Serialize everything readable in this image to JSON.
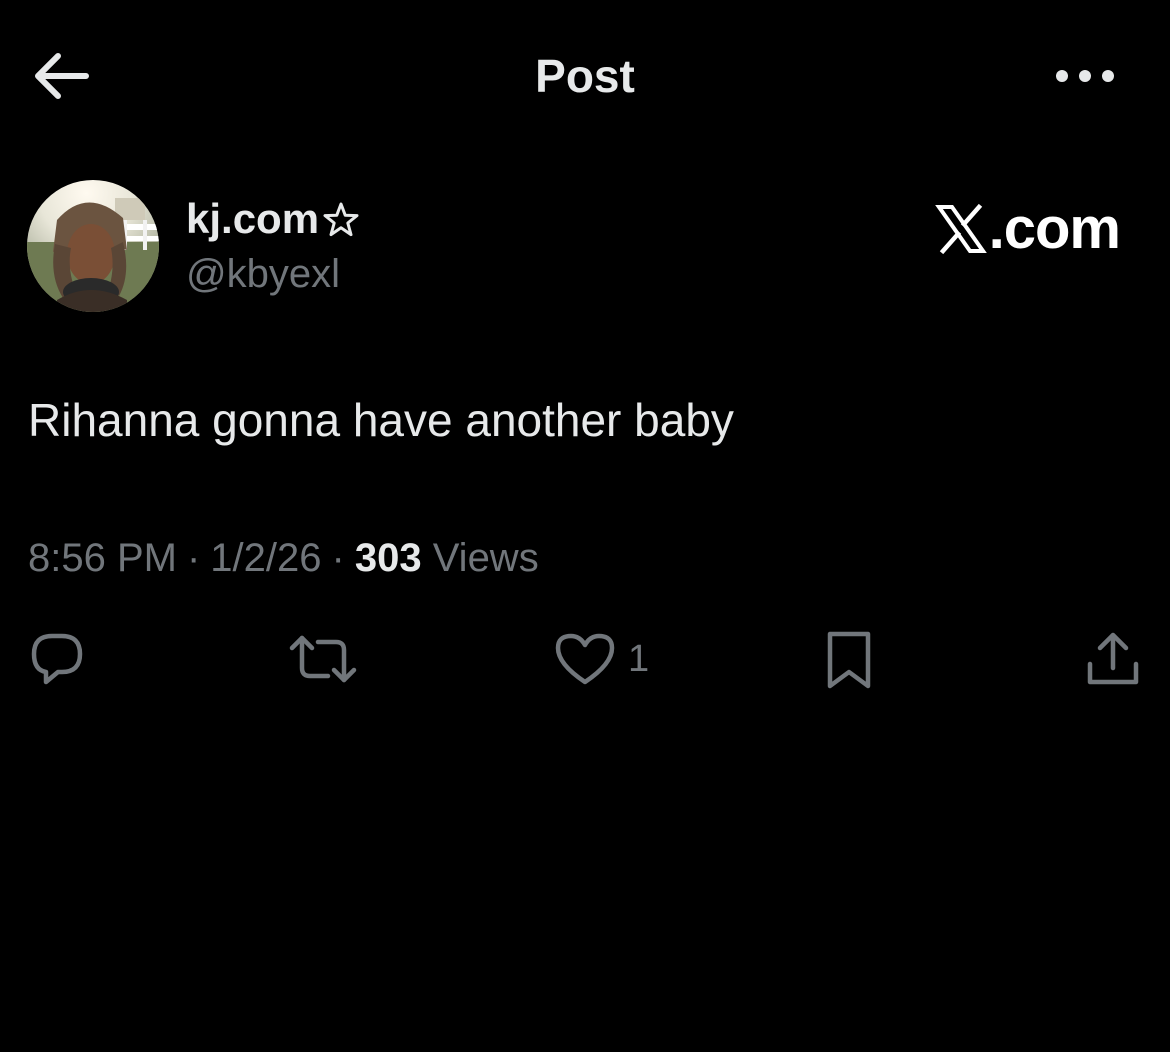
{
  "header": {
    "title": "Post",
    "back_icon": "arrow-left-icon",
    "more_icon": "more-horizontal-icon"
  },
  "author": {
    "display_name": "kj.com",
    "name_icon": "star-outline-icon",
    "handle": "@kbyexl",
    "avatar": "avatar-photo"
  },
  "brand": {
    "icon": "x-logo-icon",
    "text": ".com"
  },
  "post": {
    "text": "Rihanna gonna have another baby"
  },
  "meta": {
    "time": "8:56 PM",
    "separator": "·",
    "date": "1/2/26",
    "views_count": "303",
    "views_label": "Views"
  },
  "actions": {
    "reply_icon": "reply-icon",
    "repost_icon": "repost-icon",
    "like_icon": "heart-outline-icon",
    "like_count": "1",
    "bookmark_icon": "bookmark-icon",
    "share_icon": "share-icon"
  },
  "colors": {
    "background": "#000000",
    "primary_text": "#e7e9ea",
    "secondary_text": "#71767b"
  }
}
